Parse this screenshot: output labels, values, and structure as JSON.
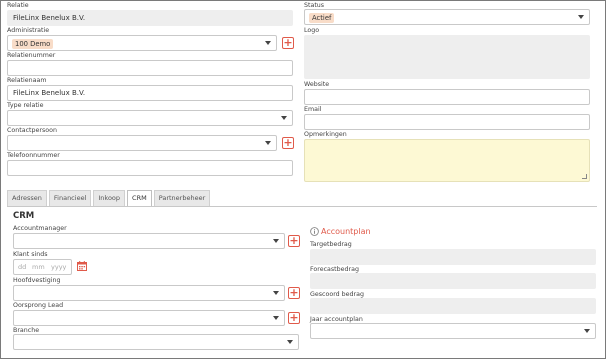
{
  "left": {
    "relatie": {
      "label": "Relatie",
      "value": "FileLinx Benelux B.V."
    },
    "administratie": {
      "label": "Administratie",
      "value": "100 Demo"
    },
    "relatienummer": {
      "label": "Relatienummer",
      "value": ""
    },
    "relatienaam": {
      "label": "Relatienaam",
      "value": "FileLinx Benelux B.V."
    },
    "type_relatie": {
      "label": "Type relatie",
      "value": ""
    },
    "contactpersoon": {
      "label": "Contactpersoon",
      "value": ""
    },
    "telefoonnummer": {
      "label": "Telefoonnummer",
      "value": ""
    }
  },
  "right": {
    "status": {
      "label": "Status",
      "value": "Actief"
    },
    "logo": {
      "label": "Logo"
    },
    "website": {
      "label": "Website",
      "value": ""
    },
    "email": {
      "label": "Email",
      "value": ""
    },
    "opmerkingen": {
      "label": "Opmerkingen",
      "value": ""
    }
  },
  "tabs": [
    {
      "label": "Adressen"
    },
    {
      "label": "Financieel"
    },
    {
      "label": "Inkoop"
    },
    {
      "label": "CRM",
      "active": true
    },
    {
      "label": "Partnerbeheer"
    }
  ],
  "crm": {
    "title": "CRM",
    "accountmanager": {
      "label": "Accountmanager",
      "value": ""
    },
    "klant_sinds": {
      "label": "Klant sinds",
      "dd": "dd",
      "mm": "mm",
      "yyyy": "yyyy"
    },
    "hoofdvestiging": {
      "label": "Hoofdvestiging",
      "value": ""
    },
    "oorsprong_lead": {
      "label": "Oorsprong Lead",
      "value": ""
    },
    "branche": {
      "label": "Branche",
      "value": ""
    }
  },
  "accountplan": {
    "title": "Accountplan",
    "icon": "info-icon",
    "targetbedrag": {
      "label": "Targetbedrag"
    },
    "forecastbedrag": {
      "label": "Forecastbedrag"
    },
    "gescoord_bedrag": {
      "label": "Gescoord bedrag"
    },
    "jaar_accountplan": {
      "label": "Jaar accountplan",
      "value": ""
    }
  },
  "colors": {
    "accent": "#e05a4a",
    "chip": "#f8dcc8",
    "readonly": "#eeeeee",
    "note": "#fdf9d4"
  }
}
